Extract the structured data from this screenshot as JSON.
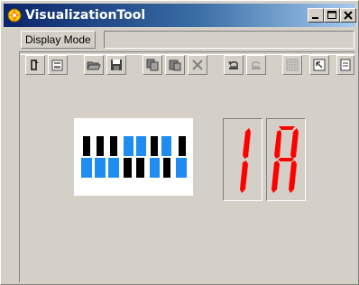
{
  "window": {
    "title": "VisualizationTool",
    "controls": [
      "minimize",
      "maximize",
      "close"
    ]
  },
  "menu": {
    "items": [
      {
        "label": "Display Mode"
      }
    ]
  },
  "toolbar": {
    "buttons": [
      {
        "icon": "save-flash-icon"
      },
      {
        "icon": "properties-icon"
      },
      {
        "icon": "open-folder-icon"
      },
      {
        "icon": "floppy-disk-icon"
      },
      {
        "icon": "copy-icon"
      },
      {
        "icon": "paste-icon"
      },
      {
        "icon": "delete-x-icon"
      },
      {
        "icon": "undo-icon"
      },
      {
        "icon": "redo-icon"
      },
      {
        "icon": "grid-icon"
      },
      {
        "icon": "zoom-fit-icon"
      },
      {
        "icon": "settings-icon"
      }
    ]
  },
  "display": {
    "keys_pattern": [
      "dark",
      "blue",
      "dark",
      "blue",
      "dark",
      "blue",
      "dark",
      "blue",
      "dark",
      "blue",
      "dark",
      "blue",
      "dark",
      "blue"
    ],
    "segment_digits": [
      "1",
      "A"
    ],
    "colors": {
      "segment_on": "#ff0000",
      "key_dark": "#000000",
      "key_blue": "#1e8cf0"
    }
  }
}
